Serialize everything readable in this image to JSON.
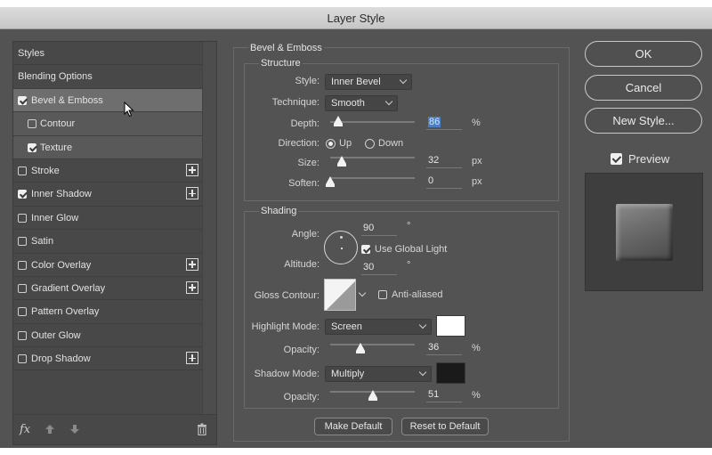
{
  "window": {
    "title": "Layer Style"
  },
  "styles_panel": {
    "items": [
      {
        "label": "Styles",
        "kind": "plain",
        "checked": false,
        "plus": false
      },
      {
        "label": "Blending Options",
        "kind": "plain",
        "checked": false,
        "plus": false
      },
      {
        "label": "Bevel & Emboss",
        "kind": "check",
        "checked": true,
        "plus": false,
        "selected": true
      },
      {
        "label": "Contour",
        "kind": "sub",
        "checked": false,
        "plus": false
      },
      {
        "label": "Texture",
        "kind": "sub",
        "checked": true,
        "plus": false
      },
      {
        "label": "Stroke",
        "kind": "check",
        "checked": false,
        "plus": true
      },
      {
        "label": "Inner Shadow",
        "kind": "check",
        "checked": true,
        "plus": true
      },
      {
        "label": "Inner Glow",
        "kind": "check",
        "checked": false,
        "plus": false
      },
      {
        "label": "Satin",
        "kind": "check",
        "checked": false,
        "plus": false
      },
      {
        "label": "Color Overlay",
        "kind": "check",
        "checked": false,
        "plus": true
      },
      {
        "label": "Gradient Overlay",
        "kind": "check",
        "checked": false,
        "plus": true
      },
      {
        "label": "Pattern Overlay",
        "kind": "check",
        "checked": false,
        "plus": false
      },
      {
        "label": "Outer Glow",
        "kind": "check",
        "checked": false,
        "plus": false
      },
      {
        "label": "Drop Shadow",
        "kind": "check",
        "checked": false,
        "plus": true
      }
    ],
    "footer": {
      "fx_label": "fx",
      "icons": [
        "fx-icon",
        "arrow-up-icon",
        "arrow-down-icon",
        "trash-icon"
      ]
    }
  },
  "bevel": {
    "section_title": "Bevel & Emboss",
    "structure": {
      "title": "Structure",
      "style_label": "Style:",
      "style_value": "Inner Bevel",
      "technique_label": "Technique:",
      "technique_value": "Smooth",
      "depth_label": "Depth:",
      "depth_value": "86",
      "depth_unit": "%",
      "depth_level": 0.09,
      "direction_label": "Direction:",
      "direction_up": "Up",
      "direction_down": "Down",
      "direction_selected": "Up",
      "size_label": "Size:",
      "size_value": "32",
      "size_unit": "px",
      "size_level": 0.14,
      "soften_label": "Soften:",
      "soften_value": "0",
      "soften_unit": "px",
      "soften_level": 0.0
    },
    "shading": {
      "title": "Shading",
      "angle_label": "Angle:",
      "angle_value": "90",
      "angle_unit": "°",
      "global_light_label": "Use Global Light",
      "global_light_checked": true,
      "altitude_label": "Altitude:",
      "altitude_value": "30",
      "altitude_unit": "°",
      "gloss_contour_label": "Gloss Contour:",
      "anti_aliased_label": "Anti-aliased",
      "anti_aliased_checked": false,
      "highlight_mode_label": "Highlight Mode:",
      "highlight_mode_value": "Screen",
      "highlight_color": "#ffffff",
      "highlight_opacity_label": "Opacity:",
      "highlight_opacity_value": "36",
      "highlight_opacity_unit": "%",
      "highlight_opacity_level": 0.36,
      "shadow_mode_label": "Shadow Mode:",
      "shadow_mode_value": "Multiply",
      "shadow_color": "#1a1a1a",
      "shadow_opacity_label": "Opacity:",
      "shadow_opacity_value": "51",
      "shadow_opacity_unit": "%",
      "shadow_opacity_level": 0.51
    },
    "make_default_label": "Make Default",
    "reset_default_label": "Reset to Default"
  },
  "actions": {
    "ok_label": "OK",
    "cancel_label": "Cancel",
    "new_style_label": "New Style...",
    "preview_label": "Preview",
    "preview_checked": true
  }
}
